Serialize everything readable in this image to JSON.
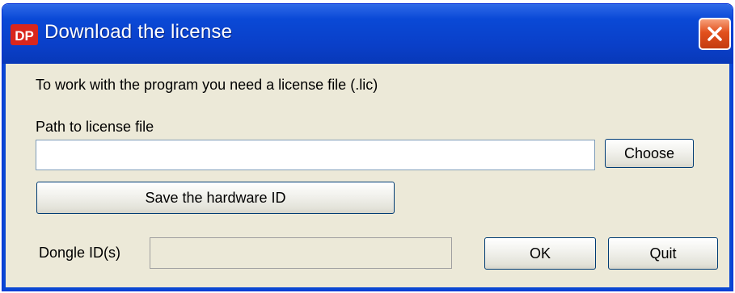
{
  "window": {
    "title": "Download the license",
    "app_icon": "dp-logo-icon",
    "close_icon": "close-icon"
  },
  "message": "To work with the program you need a license file (.lic)",
  "path_field": {
    "label": "Path to license file",
    "value": ""
  },
  "buttons": {
    "choose": "Choose",
    "save_hardware_id": "Save the hardware ID",
    "ok": "OK",
    "quit": "Quit"
  },
  "dongle": {
    "label": "Dongle ID(s)",
    "value": ""
  },
  "colors": {
    "titlebar": "#0a49d6",
    "close_button": "#e2501c",
    "dialog_background": "#ece9d8",
    "button_border": "#003c74"
  }
}
